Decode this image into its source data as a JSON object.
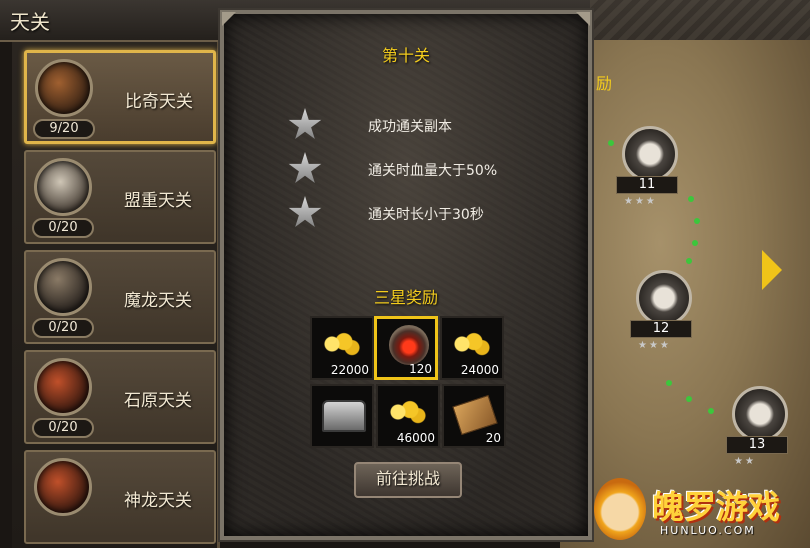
{
  "header": {
    "title": "天关"
  },
  "sidebar": {
    "items": [
      {
        "name": "比奇天关",
        "progress": "9/20",
        "active": true
      },
      {
        "name": "盟重天关",
        "progress": "0/20"
      },
      {
        "name": "魔龙天关",
        "progress": "0/20"
      },
      {
        "name": "石原天关",
        "progress": "0/20"
      },
      {
        "name": "神龙天关"
      }
    ]
  },
  "panel": {
    "stage_title": "第十关",
    "conditions": [
      {
        "text": "成功通关副本",
        "icon": "star-icon"
      },
      {
        "text": "通关时血量大于50%",
        "icon": "star-icon"
      },
      {
        "text": "通关时长小于30秒",
        "icon": "star-icon"
      }
    ],
    "reward_title": "三星奖励",
    "rewards": [
      {
        "icon": "gold-icon",
        "qty": "22000"
      },
      {
        "icon": "gem-icon",
        "qty": "120",
        "selected": true
      },
      {
        "icon": "gold-icon",
        "qty": "24000"
      },
      {
        "icon": "chest-icon",
        "qty": ""
      },
      {
        "icon": "gold-icon",
        "qty": "46000"
      },
      {
        "icon": "scroll-icon",
        "qty": "20"
      }
    ],
    "challenge_label": "前往挑战"
  },
  "map": {
    "label": "励",
    "nodes": [
      {
        "num": "11",
        "stars": "★★★"
      },
      {
        "num": "12",
        "stars": "★★★"
      },
      {
        "num": "13",
        "stars": "★★"
      }
    ]
  },
  "watermark": {
    "brand": "魄罗游戏",
    "domain": "HUNLUO.COM"
  },
  "colors": {
    "accent_gold": "#f3cc1d",
    "selected_border": "#f0c419",
    "path_green": "#3cc63c"
  }
}
